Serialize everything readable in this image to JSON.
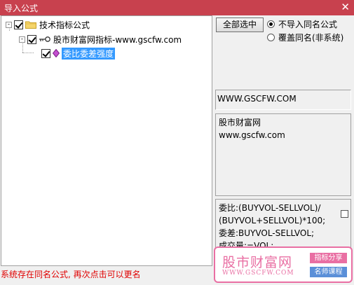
{
  "window": {
    "title": "导入公式",
    "close_glyph": "✕"
  },
  "tree": {
    "root": {
      "label": "技术指标公式",
      "checked": true,
      "expander": "-"
    },
    "child": {
      "label": "股市财富网指标-www.gscfw.com",
      "checked": true,
      "expander": "-"
    },
    "leaf": {
      "label": "委比委差强度",
      "checked": true,
      "expander": "-"
    }
  },
  "options": {
    "select_all_label": "全部选中",
    "radio_skip_label": "不导入同名公式",
    "radio_overwrite_label": "覆盖同名(非系统)",
    "selected_radio": "skip"
  },
  "info": {
    "url": "WWW.GSCFW.COM",
    "description_lines": [
      "股市财富网",
      "www.gscfw.com"
    ],
    "code_lines": [
      "委比:(BUYVOL-SELLVOL)/",
      "(BUYVOL+SELLVOL)*100;",
      "委差:BUYVOL-SELLVOL;",
      "成交量:=VOL;"
    ]
  },
  "status": {
    "message": "系统存在同名公式, 再次点击可以更名"
  },
  "watermark": {
    "brand": "股市财富网",
    "url": "WWW.GSCFW.COM",
    "tag1": "指标分享",
    "tag2": "名师课程"
  },
  "colors": {
    "titlebar": "#c8414e",
    "selection": "#3399ff",
    "status_text": "#e00000",
    "watermark": "#e96fa3"
  }
}
